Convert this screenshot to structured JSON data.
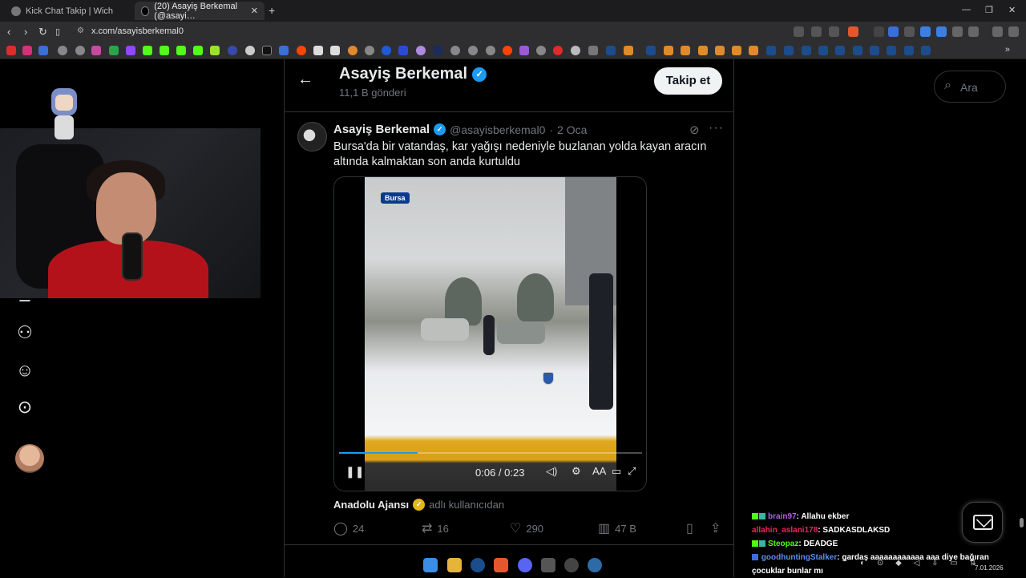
{
  "browser": {
    "tabs": [
      {
        "label": "Kick Chat Takip | Wich",
        "active": false
      },
      {
        "label": "(20) Asayiş Berkemal (@asayi…",
        "active": true
      }
    ],
    "new_tab": "+",
    "url": "x.com/asayisberkemal0",
    "window_controls": [
      "minimize-icon",
      "restore-icon",
      "close-icon"
    ]
  },
  "profile": {
    "name": "Asayiş Berkemal",
    "post_count": "11,1 B gönderi",
    "follow_label": "Takip et"
  },
  "tweet": {
    "author": "Asayiş Berkemal",
    "handle": "@asayisberkemal0",
    "date": "2 Oca",
    "separator": "·",
    "text": "Bursa'da bir vatandaş, kar yağışı nedeniyle buzlanan yolda kayan aracın altında kalmaktan son anda kurtuldu",
    "video": {
      "badge": "Bursa",
      "time": "0:06 / 0:23",
      "progress": 0.26
    },
    "source_name": "Anadolu Ajansı",
    "source_suffix": "adlı kullanıcıdan",
    "stats": {
      "replies": "24",
      "reposts": "16",
      "likes": "290",
      "views": "47 B"
    }
  },
  "search": {
    "placeholder": "Ara"
  },
  "chat": [
    {
      "user": "brain97",
      "color": "#b45cf0",
      "text": ": Allahu ekber"
    },
    {
      "user": "allahin_aslani178",
      "color": "#e8295c",
      "text": ": SADKASDLAKSD"
    },
    {
      "user": "Steopaz",
      "color": "#53fc18",
      "text": ": DEADGE"
    },
    {
      "user": "goodhuntingStalker",
      "color": "#5c8ff0",
      "text": ": gardaş aaaaaaaaaaaa aaa diye bağıran çocuklar bunlar mı"
    }
  ],
  "tray": {
    "date": "7.01.2026"
  },
  "colors": {
    "accent": "#1d9bf0",
    "kick_green": "#53fc18"
  }
}
